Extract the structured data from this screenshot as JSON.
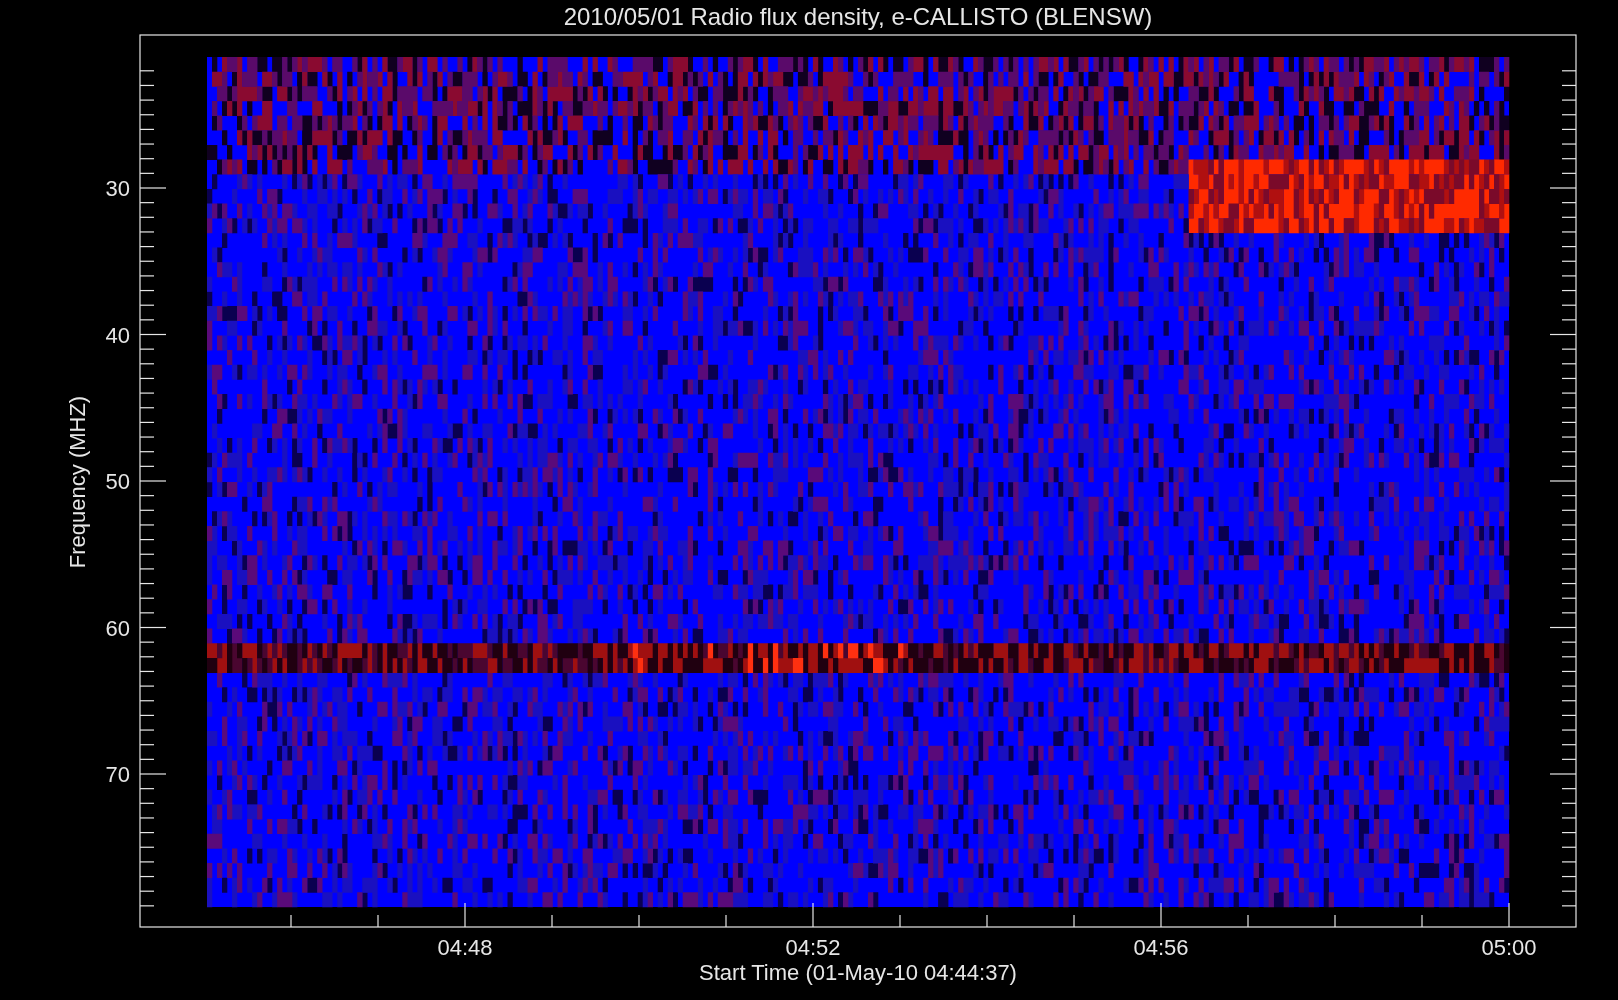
{
  "title": "2010/05/01  Radio flux density, e-CALLISTO (BLENSW)",
  "xlabel": "Start Time (01-May-10 04:44:37)",
  "ylabel": "Frequency (MHZ)",
  "xticks": [
    "04:48",
    "04:52",
    "04:56",
    "05:00"
  ],
  "yticks": [
    "30",
    "40",
    "50",
    "60",
    "70"
  ]
}
